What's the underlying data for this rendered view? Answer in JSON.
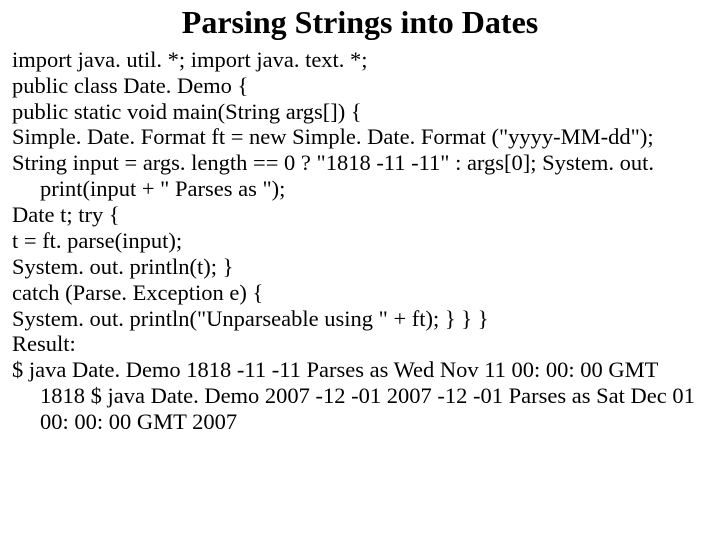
{
  "title": "Parsing Strings into Dates",
  "lines": [
    "import java. util. *; import java. text. *;",
    "public class Date. Demo {",
    " public static void main(String args[]) {",
    " Simple. Date. Format ft = new Simple. Date. Format (\"yyyy-MM-dd\");",
    "String input = args. length == 0 ? \"1818 -11 -11\" : args[0]; System. out. print(input + \" Parses as \");",
    " Date t;  try {",
    "t = ft. parse(input);",
    " System. out. println(t); }",
    "catch (Parse. Exception e) {",
    "System. out. println(\"Unparseable using \" + ft);  } } }",
    "Result:",
    "$ java Date. Demo 1818 -11 -11 Parses as Wed Nov 11 00: 00: 00 GMT 1818 $ java Date. Demo 2007 -12 -01 2007 -12 -01 Parses as Sat Dec 01 00: 00: 00 GMT 2007"
  ]
}
